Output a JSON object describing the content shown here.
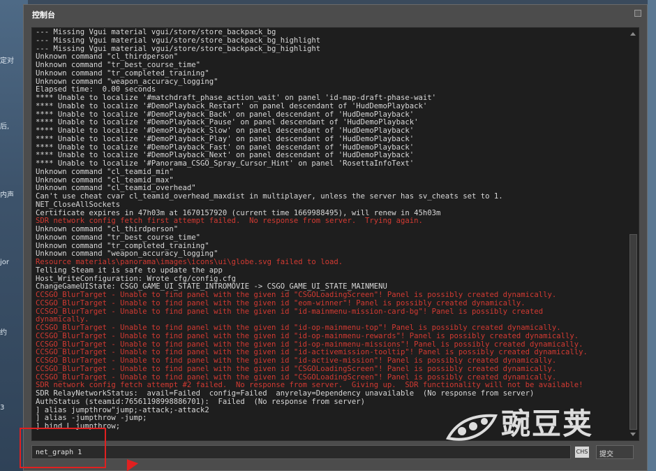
{
  "window": {
    "title": "控制台"
  },
  "background": {
    "fragments": [
      "定对",
      "后,",
      "内声",
      "jor",
      "约",
      "3"
    ]
  },
  "console": {
    "lines": [
      {
        "text": "--- Missing Vgui material vgui/store/store_backpack_bg",
        "type": "normal"
      },
      {
        "text": "--- Missing Vgui material vgui/store/store_backpack_bg_highlight",
        "type": "normal"
      },
      {
        "text": "--- Missing Vgui material vgui/store/store_backpack_bg_highlight",
        "type": "normal"
      },
      {
        "text": "Unknown command \"cl_thirdperson\"",
        "type": "normal"
      },
      {
        "text": "Unknown command \"tr_best_course_time\"",
        "type": "normal"
      },
      {
        "text": "Unknown command \"tr_completed_training\"",
        "type": "normal"
      },
      {
        "text": "Unknown command \"weapon_accuracy_logging\"",
        "type": "normal"
      },
      {
        "text": "Elapsed time:  0.00 seconds",
        "type": "normal"
      },
      {
        "text": "**** Unable to localize '#matchdraft_phase_action_wait' on panel 'id-map-draft-phase-wait'",
        "type": "normal"
      },
      {
        "text": "**** Unable to localize '#DemoPlayback_Restart' on panel descendant of 'HudDemoPlayback'",
        "type": "normal"
      },
      {
        "text": "**** Unable to localize '#DemoPlayback_Back' on panel descendant of 'HudDemoPlayback'",
        "type": "normal"
      },
      {
        "text": "**** Unable to localize '#DemoPlayback_Pause' on panel descendant of 'HudDemoPlayback'",
        "type": "normal"
      },
      {
        "text": "**** Unable to localize '#DemoPlayback_Slow' on panel descendant of 'HudDemoPlayback'",
        "type": "normal"
      },
      {
        "text": "**** Unable to localize '#DemoPlayback_Play' on panel descendant of 'HudDemoPlayback'",
        "type": "normal"
      },
      {
        "text": "**** Unable to localize '#DemoPlayback_Fast' on panel descendant of 'HudDemoPlayback'",
        "type": "normal"
      },
      {
        "text": "**** Unable to localize '#DemoPlayback_Next' on panel descendant of 'HudDemoPlayback'",
        "type": "normal"
      },
      {
        "text": "**** Unable to localize '#Panorama_CSGO_Spray_Cursor_Hint' on panel 'RosettaInfoText'",
        "type": "normal"
      },
      {
        "text": "Unknown command \"cl_teamid_min\"",
        "type": "normal"
      },
      {
        "text": "Unknown command \"cl_teamid_max\"",
        "type": "normal"
      },
      {
        "text": "Unknown command \"cl_teamid_overhead\"",
        "type": "normal"
      },
      {
        "text": "Can't use cheat cvar cl_teamid_overhead_maxdist in multiplayer, unless the server has sv_cheats set to 1.",
        "type": "normal"
      },
      {
        "text": "NET_CloseAllSockets",
        "type": "normal"
      },
      {
        "text": "Certificate expires in 47h03m at 1670157920 (current time 1669988495), will renew in 45h03m",
        "type": "normal"
      },
      {
        "text": "SDR network config fetch first attempt failed.  No response from server.  Trying again.",
        "type": "error"
      },
      {
        "text": "Unknown command \"cl_thirdperson\"",
        "type": "normal"
      },
      {
        "text": "Unknown command \"tr_best_course_time\"",
        "type": "normal"
      },
      {
        "text": "Unknown command \"tr_completed_training\"",
        "type": "normal"
      },
      {
        "text": "Unknown command \"weapon_accuracy_logging\"",
        "type": "normal"
      },
      {
        "text": "Resource materials\\panorama\\images\\icons\\ui\\globe.svg failed to load.",
        "type": "error"
      },
      {
        "text": "Telling Steam it is safe to update the app",
        "type": "normal"
      },
      {
        "text": "Host_WriteConfiguration: Wrote cfg/config.cfg",
        "type": "normal"
      },
      {
        "text": "ChangeGameUIState: CSGO_GAME_UI_STATE_INTROMOVIE -> CSGO_GAME_UI_STATE_MAINMENU",
        "type": "normal"
      },
      {
        "text": "CCSGO_BlurTarget - Unable to find panel with the given id \"CSGOLoadingScreen\"! Panel is possibly created dynamically.",
        "type": "error"
      },
      {
        "text": "CCSGO_BlurTarget - Unable to find panel with the given id \"eom-winner\"! Panel is possibly created dynamically.",
        "type": "error"
      },
      {
        "text": "CCSGO_BlurTarget - Unable to find panel with the given id \"id-mainmenu-mission-card-bg\"! Panel is possibly created",
        "type": "error"
      },
      {
        "text": "dynamically.",
        "type": "error"
      },
      {
        "text": "CCSGO_BlurTarget - Unable to find panel with the given id \"id-op-mainmenu-top\"! Panel is possibly created dynamically.",
        "type": "error"
      },
      {
        "text": "CCSGO_BlurTarget - Unable to find panel with the given id \"id-op-mainmenu-rewards\"! Panel is possibly created dynamically.",
        "type": "error"
      },
      {
        "text": "CCSGO_BlurTarget - Unable to find panel with the given id \"id-op-mainmenu-missions\"! Panel is possibly created dynamically.",
        "type": "error"
      },
      {
        "text": "CCSGO_BlurTarget - Unable to find panel with the given id \"id-activemission-tooltip\"! Panel is possibly created dynamically.",
        "type": "error"
      },
      {
        "text": "CCSGO_BlurTarget - Unable to find panel with the given id \"id-active-mission\"! Panel is possibly created dynamically.",
        "type": "error"
      },
      {
        "text": "CCSGO_BlurTarget - Unable to find panel with the given id \"CSGOLoadingScreen\"! Panel is possibly created dynamically.",
        "type": "error"
      },
      {
        "text": "CCSGO_BlurTarget - Unable to find panel with the given id \"CSGOLoadingScreen\"! Panel is possibly created dynamically.",
        "type": "error"
      },
      {
        "text": "SDR network config fetch attempt #2 failed.  No response from server.  Giving up.  SDR functionality will not be available!",
        "type": "error"
      },
      {
        "text": "SDR RelayNetworkStatus:  avail=Failed  config=Failed  anyrelay=Dependency unavailable  (No response from server)",
        "type": "normal"
      },
      {
        "text": "AuthStatus (steamid:76561198998886701):  Failed  (No response from server)",
        "type": "normal"
      },
      {
        "text": "] alias jumpthrow\"jump;-attack;-attack2",
        "type": "normal"
      },
      {
        "text": "] alias -jumpthrow -jump;",
        "type": "normal"
      },
      {
        "text": "] bind L jumpthrow;",
        "type": "normal"
      }
    ]
  },
  "input": {
    "value": "net_graph 1",
    "placeholder": ""
  },
  "ime": {
    "label": "CHS"
  },
  "submit": {
    "label": "提交"
  },
  "watermark": {
    "text": "豌豆荚"
  },
  "colors": {
    "error": "#d23a32",
    "normal": "#d8d8d8",
    "highlight": "#e02020"
  }
}
